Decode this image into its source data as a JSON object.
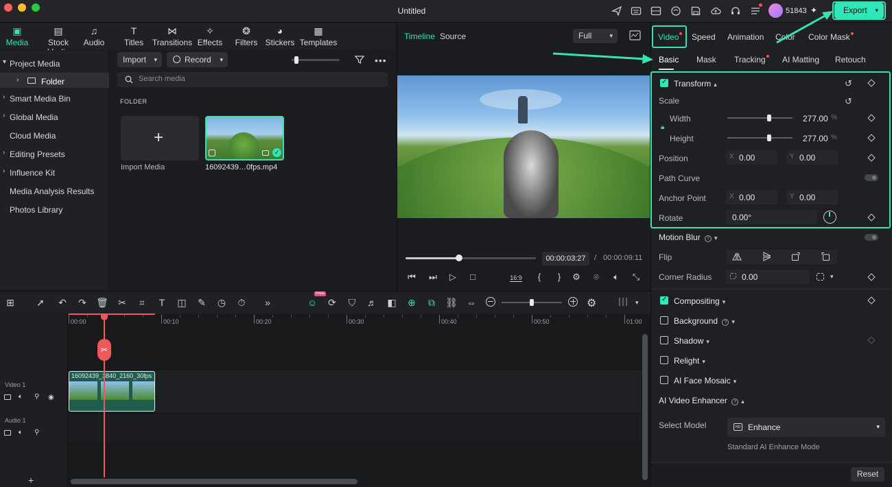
{
  "window": {
    "title": "Untitled"
  },
  "account": {
    "credits": "51843"
  },
  "export": {
    "label": "Export"
  },
  "media_tabs": [
    {
      "label": "Media",
      "icon": "media-icon",
      "active": true
    },
    {
      "label": "Stock Media",
      "icon": "stock-media-icon"
    },
    {
      "label": "Audio",
      "icon": "audio-icon"
    },
    {
      "label": "Titles",
      "icon": "titles-icon"
    },
    {
      "label": "Transitions",
      "icon": "transitions-icon"
    },
    {
      "label": "Effects",
      "icon": "effects-icon"
    },
    {
      "label": "Filters",
      "icon": "filters-icon"
    },
    {
      "label": "Stickers",
      "icon": "stickers-icon"
    },
    {
      "label": "Templates",
      "icon": "templates-icon"
    }
  ],
  "sidebar": {
    "items": [
      "Project Media",
      "Folder",
      "Smart Media Bin",
      "Global Media",
      "Cloud Media",
      "Editing Presets",
      "Influence Kit",
      "Media Analysis Results",
      "Photos Library"
    ]
  },
  "media": {
    "import_label": "Import",
    "record_label": "Record",
    "search_placeholder": "Search media",
    "folder_heading": "FOLDER",
    "import_media_label": "Import Media",
    "clip_name": "16092439…0fps.mp4"
  },
  "preview": {
    "tab_timeline": "Timeline",
    "tab_source": "Source",
    "quality": "Full",
    "current_time": "00:00:03:27",
    "separator": "/",
    "total_time": "00:00:09:11",
    "aspect_label": "16:9",
    "progress": 0.41
  },
  "timeline": {
    "ruler": [
      "00:00",
      "00:10",
      "00:20",
      "00:30",
      "00:40",
      "00:50",
      "01:00"
    ],
    "video_track": "Video 1",
    "audio_track": "Audio 1",
    "clip_label": "16092439_3840_2160_30fps",
    "free_badge": "FREE",
    "zoom": 0.5
  },
  "props": {
    "top_tabs": [
      "Video",
      "Speed",
      "Animation",
      "Color",
      "Color Mask"
    ],
    "sub_tabs": [
      "Basic",
      "Mask",
      "Tracking",
      "AI Matting",
      "Retouch"
    ],
    "transform_title": "Transform",
    "scale_label": "Scale",
    "width_label": "Width",
    "width_value": "277.00",
    "height_label": "Height",
    "height_value": "277.00",
    "percent": "%",
    "position_label": "Position",
    "x_label": "X",
    "y_label": "Y",
    "pos_x": "0.00",
    "pos_y": "0.00",
    "path_curve_label": "Path Curve",
    "anchor_label": "Anchor Point",
    "anchor_x": "0.00",
    "anchor_y": "0.00",
    "rotate_label": "Rotate",
    "rotate_value": "0.00°",
    "motion_blur_label": "Motion Blur",
    "flip_label": "Flip",
    "corner_radius_label": "Corner Radius",
    "corner_radius_value": "0.00",
    "compositing_label": "Compositing",
    "background_label": "Background",
    "shadow_label": "Shadow",
    "relight_label": "Relight",
    "face_mosaic_label": "AI Face Mosaic",
    "enhancer_label": "AI Video Enhancer",
    "select_model_label": "Select Model",
    "model_value": "Enhance",
    "model_hint": "Standard AI Enhance Mode",
    "reset_label": "Reset"
  },
  "colors": {
    "accent": "#2ee6b6",
    "highlight": "#3be0b0",
    "playhead": "#f0595b"
  }
}
